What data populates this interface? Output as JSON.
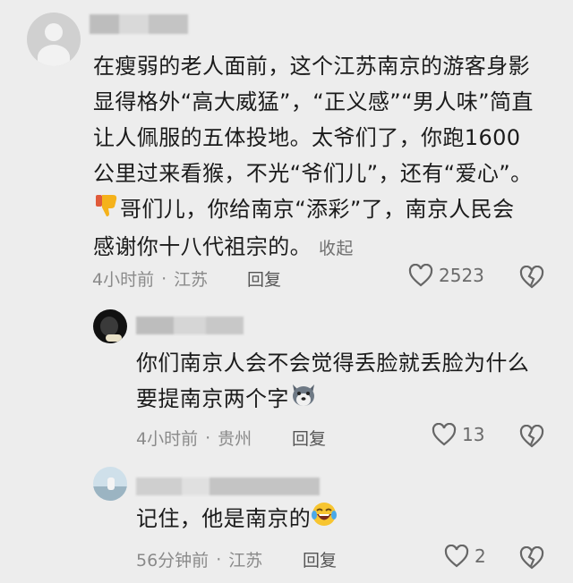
{
  "comments": [
    {
      "name": "",
      "text_lines": [
        "在瘦弱的老人面前，这个江苏南京的游客身影",
        "显得格外“高大威猛”，“正义感”“男人味”简直",
        "让人佩服的五体投地。太爷们了，你跑1600",
        "公里过来看猴，不光“爷们儿”，还有“爱心”。",
        "哥们儿，你给南京“添彩”了，南京人民会",
        "感谢你十八代祖宗的。"
      ],
      "collapse_label": "收起",
      "time": "4小时前",
      "location": "江苏",
      "reply_label": "回复",
      "likes": "2523",
      "emoji": "thumbs-down-icon"
    },
    {
      "name": "",
      "text_lines": [
        "你们南京人会不会觉得丢脸就丢脸为什么",
        "要提南京两个字"
      ],
      "time": "4小时前",
      "location": "贵州",
      "reply_label": "回复",
      "likes": "13",
      "emoji": "husky-icon"
    },
    {
      "name": "",
      "text_lines": [
        "记住，他是南京的"
      ],
      "time": "56分钟前",
      "location": "江苏",
      "reply_label": "回复",
      "likes": "2",
      "emoji": "laughing-crying-icon"
    }
  ],
  "colors": {
    "background": "#ededed",
    "text": "#1b1b1b",
    "meta": "#8a8a8a"
  }
}
